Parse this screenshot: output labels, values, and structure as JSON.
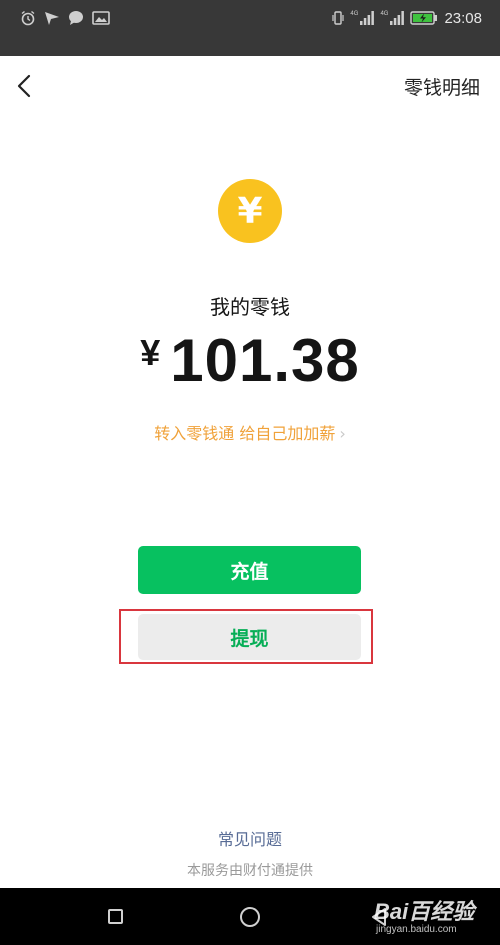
{
  "status_bar": {
    "time": "23:08",
    "network_tags": [
      "4G",
      "4G"
    ],
    "icons": [
      "alarm-icon",
      "send-icon",
      "chat-bubble-icon",
      "image-icon",
      "vibrate-icon",
      "signal-icon",
      "signal-icon",
      "battery-charging-icon"
    ],
    "battery_color": "#3fc23f"
  },
  "header": {
    "back_icon": "chevron-left-icon",
    "details_link": "零钱明细"
  },
  "wallet": {
    "icon_glyph": "¥",
    "icon_color": "#f9c21f",
    "title": "我的零钱",
    "currency_symbol": "¥",
    "amount": "101.38",
    "promo_text": "转入零钱通 给自己加加薪",
    "promo_chevron": "›"
  },
  "actions": {
    "recharge_label": "充值",
    "withdraw_label": "提现",
    "accent_green": "#07c160",
    "highlight_color": "#d9363e"
  },
  "footer": {
    "faq_link": "常见问题",
    "provider_note": "本服务由财付通提供"
  },
  "nav_bar": {
    "buttons": [
      "recent-apps-icon",
      "home-icon",
      "back-icon"
    ]
  },
  "watermark": {
    "logo_text": "Bai百经验",
    "site": "jingyan.baidu.com"
  }
}
